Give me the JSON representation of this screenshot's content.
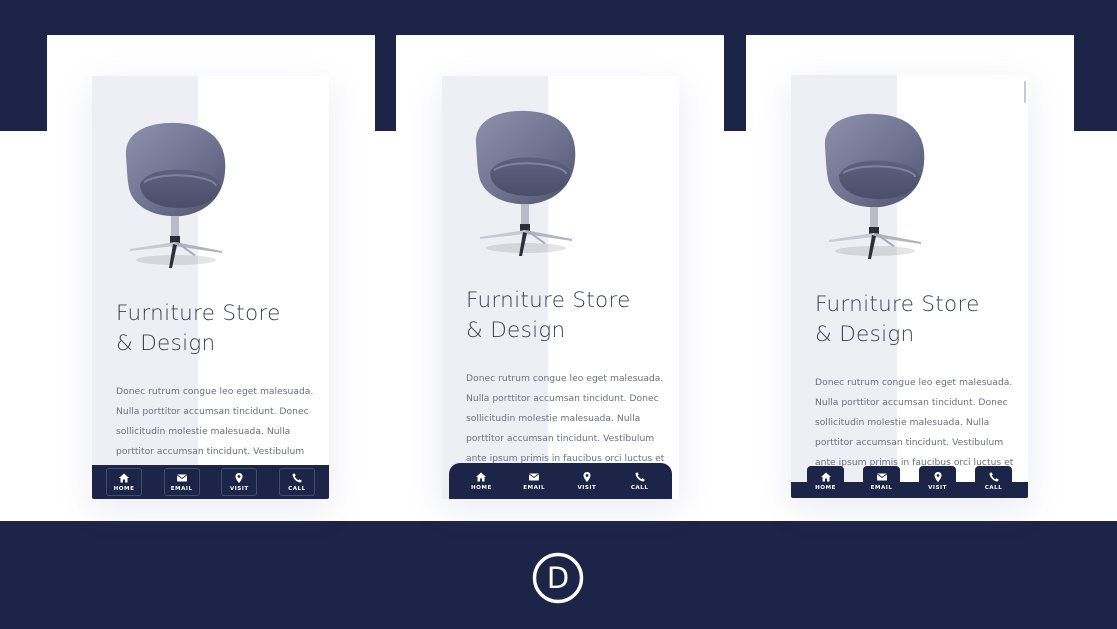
{
  "phones": [
    {
      "title_lines": [
        "Furniture Store",
        "& Design"
      ],
      "body_lines": [
        "Donec rutrum congue leo eget malesuada.",
        "Nulla porttitor accumsan tincidunt. Donec",
        "sollicitudin molestie malesuada. Nulla",
        "porttitor accumsan tincidunt. Vestibulum"
      ],
      "nav": [
        {
          "label": "HOME",
          "icon": "home-icon"
        },
        {
          "label": "EMAIL",
          "icon": "envelope-icon"
        },
        {
          "label": "VISIT",
          "icon": "map-pin-icon"
        },
        {
          "label": "CALL",
          "icon": "phone-icon"
        }
      ]
    },
    {
      "title_lines": [
        "Furniture Store",
        "& Design"
      ],
      "body_lines": [
        "Donec rutrum congue leo eget malesuada.",
        "Nulla porttitor accumsan tincidunt. Donec",
        "sollicitudin molestie malesuada. Nulla",
        "porttitor accumsan tincidunt. Vestibulum",
        "ante ipsum primis in faucibus orci luctus et"
      ],
      "nav": [
        {
          "label": "HOME",
          "icon": "home-icon"
        },
        {
          "label": "EMAIL",
          "icon": "envelope-icon"
        },
        {
          "label": "VISIT",
          "icon": "map-pin-icon"
        },
        {
          "label": "CALL",
          "icon": "phone-icon"
        }
      ]
    },
    {
      "title_lines": [
        "Furniture Store",
        "& Design"
      ],
      "body_lines": [
        "Donec rutrum congue leo eget malesuada.",
        "Nulla porttitor accumsan tincidunt. Donec",
        "sollicitudin molestie malesuada. Nulla",
        "porttitor accumsan tincidunt. Vestibulum",
        "ante ipsum primis in faucibus orci luctus et"
      ],
      "nav": [
        {
          "label": "HOME",
          "icon": "home-icon"
        },
        {
          "label": "EMAIL",
          "icon": "envelope-icon"
        },
        {
          "label": "VISIT",
          "icon": "map-pin-icon"
        },
        {
          "label": "CALL",
          "icon": "phone-icon"
        }
      ]
    }
  ],
  "logo": {
    "letter": "D",
    "icon": "divi-logo-icon"
  },
  "colors": {
    "navy": "#1c2547",
    "panel": "#eeeff4",
    "chair": "#7b7f9c"
  }
}
